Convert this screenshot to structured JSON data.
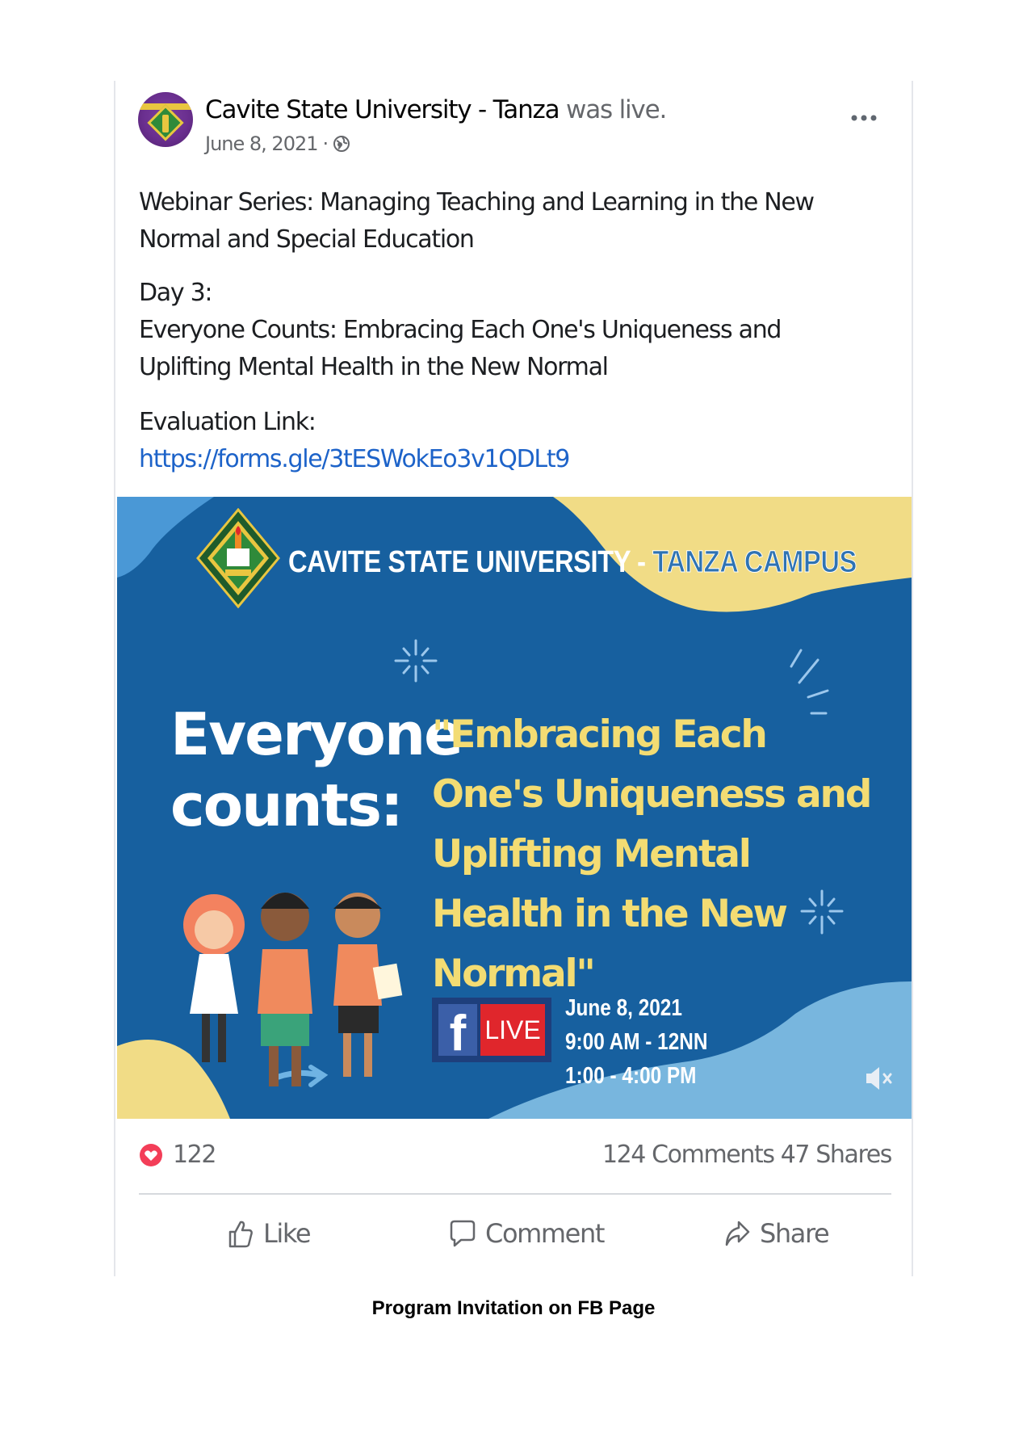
{
  "post": {
    "page_name": "Cavite State University - Tanza",
    "activity": "was live.",
    "date": "June 8, 2021",
    "separator": "·",
    "privacy_icon": "globe-icon",
    "more_icon": "more-options-icon",
    "text": {
      "line1": "Webinar Series: Managing Teaching and Learning in the New Normal and Special Education",
      "day": "Day 3:",
      "topic1": "Everyone Counts: Embracing Each One's Uniqueness and",
      "topic2": "Uplifting Mental Health in the New Normal",
      "eval_label": "Evaluation Link:",
      "eval_url": "https://forms.gle/3tESWokEo3v1QDLt9"
    }
  },
  "banner": {
    "title_main": "CAVITE STATE UNIVERSITY - ",
    "title_campus": "TANZA CAMPUS",
    "counts_line1": "Everyone",
    "counts_line2": "counts:",
    "quote": "\"Embracing Each One's Uniqueness and Uplifting Mental Health in the New Normal\"",
    "fb_letter": "f",
    "live_label": "LIVE",
    "date": "June 8, 2021",
    "time1": "9:00 AM - 12NN",
    "time2": "1:00 - 4:00 PM",
    "mute_icon": "volume-muted-icon",
    "colors": {
      "background": "#17609f",
      "yellow": "#f1dc86",
      "light_blue": "#4a98d6",
      "quote": "#f3dc73",
      "live_red": "#e0262c"
    }
  },
  "stats": {
    "reaction_icon": "heart-reaction-icon",
    "reactions": "122",
    "comments": "124 Comments",
    "shares": "47 Shares"
  },
  "actions": {
    "like": "Like",
    "comment": "Comment",
    "share": "Share"
  },
  "caption": "Program Invitation on FB Page"
}
